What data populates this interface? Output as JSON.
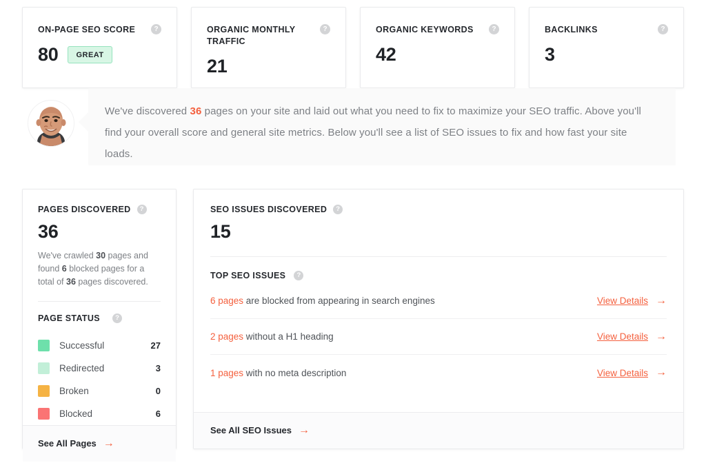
{
  "metrics": [
    {
      "title": "ON-PAGE SEO SCORE",
      "value": "80",
      "badge": "GREAT",
      "help": "?"
    },
    {
      "title": "ORGANIC MONTHLY TRAFFIC",
      "value": "21",
      "help": "?"
    },
    {
      "title": "ORGANIC KEYWORDS",
      "value": "42",
      "help": "?"
    },
    {
      "title": "BACKLINKS",
      "value": "3",
      "help": "?"
    }
  ],
  "assistant": {
    "avatar_alt": "advisor-avatar",
    "line1_a": "We've discovered ",
    "line1_count": "36",
    "line1_b": " pages on your site and laid out what you need to fix to maximize your SEO traffic. Above you'll find your overall score and general site metrics. Below you'll see a list of SEO issues to fix and how fast your site loads."
  },
  "pages_card": {
    "title": "PAGES DISCOVERED",
    "help": "?",
    "value": "36",
    "crawl_a": "We've crawled ",
    "crawl_crawled": "30",
    "crawl_b": " pages and found ",
    "crawl_blocked": "6",
    "crawl_c": " blocked pages for a total of ",
    "crawl_total": "36",
    "crawl_d": " pages discovered.",
    "status_title": "PAGE STATUS",
    "status_help": "?",
    "statuses": [
      {
        "label": "Successful",
        "count": "27",
        "color": "#6ee0ab"
      },
      {
        "label": "Redirected",
        "count": "3",
        "color": "#c2efd8"
      },
      {
        "label": "Broken",
        "count": "0",
        "color": "#f5b344"
      },
      {
        "label": "Blocked",
        "count": "6",
        "color": "#fa7474"
      }
    ],
    "footer_label": "See All Pages",
    "footer_arrow": "→"
  },
  "issues_card": {
    "title": "SEO ISSUES DISCOVERED",
    "help": "?",
    "value": "15",
    "top_title": "TOP SEO ISSUES",
    "top_help": "?",
    "rows": [
      {
        "count": "6 pages",
        "text": " are blocked from appearing in search engines",
        "action": "View Details",
        "arrow": "→"
      },
      {
        "count": "2 pages",
        "text": " without a H1 heading",
        "action": "View Details",
        "arrow": "→"
      },
      {
        "count": "1 pages",
        "text": " with no meta description",
        "action": "View Details",
        "arrow": "→"
      }
    ],
    "footer_label": "See All SEO Issues",
    "footer_arrow": "→"
  },
  "colors": {
    "accent": "#f4603e",
    "success": "#6ee0ab",
    "redirect": "#c2efd8",
    "broken": "#f5b344",
    "blocked": "#fa7474",
    "badge_bg": "#d8f6e5"
  }
}
